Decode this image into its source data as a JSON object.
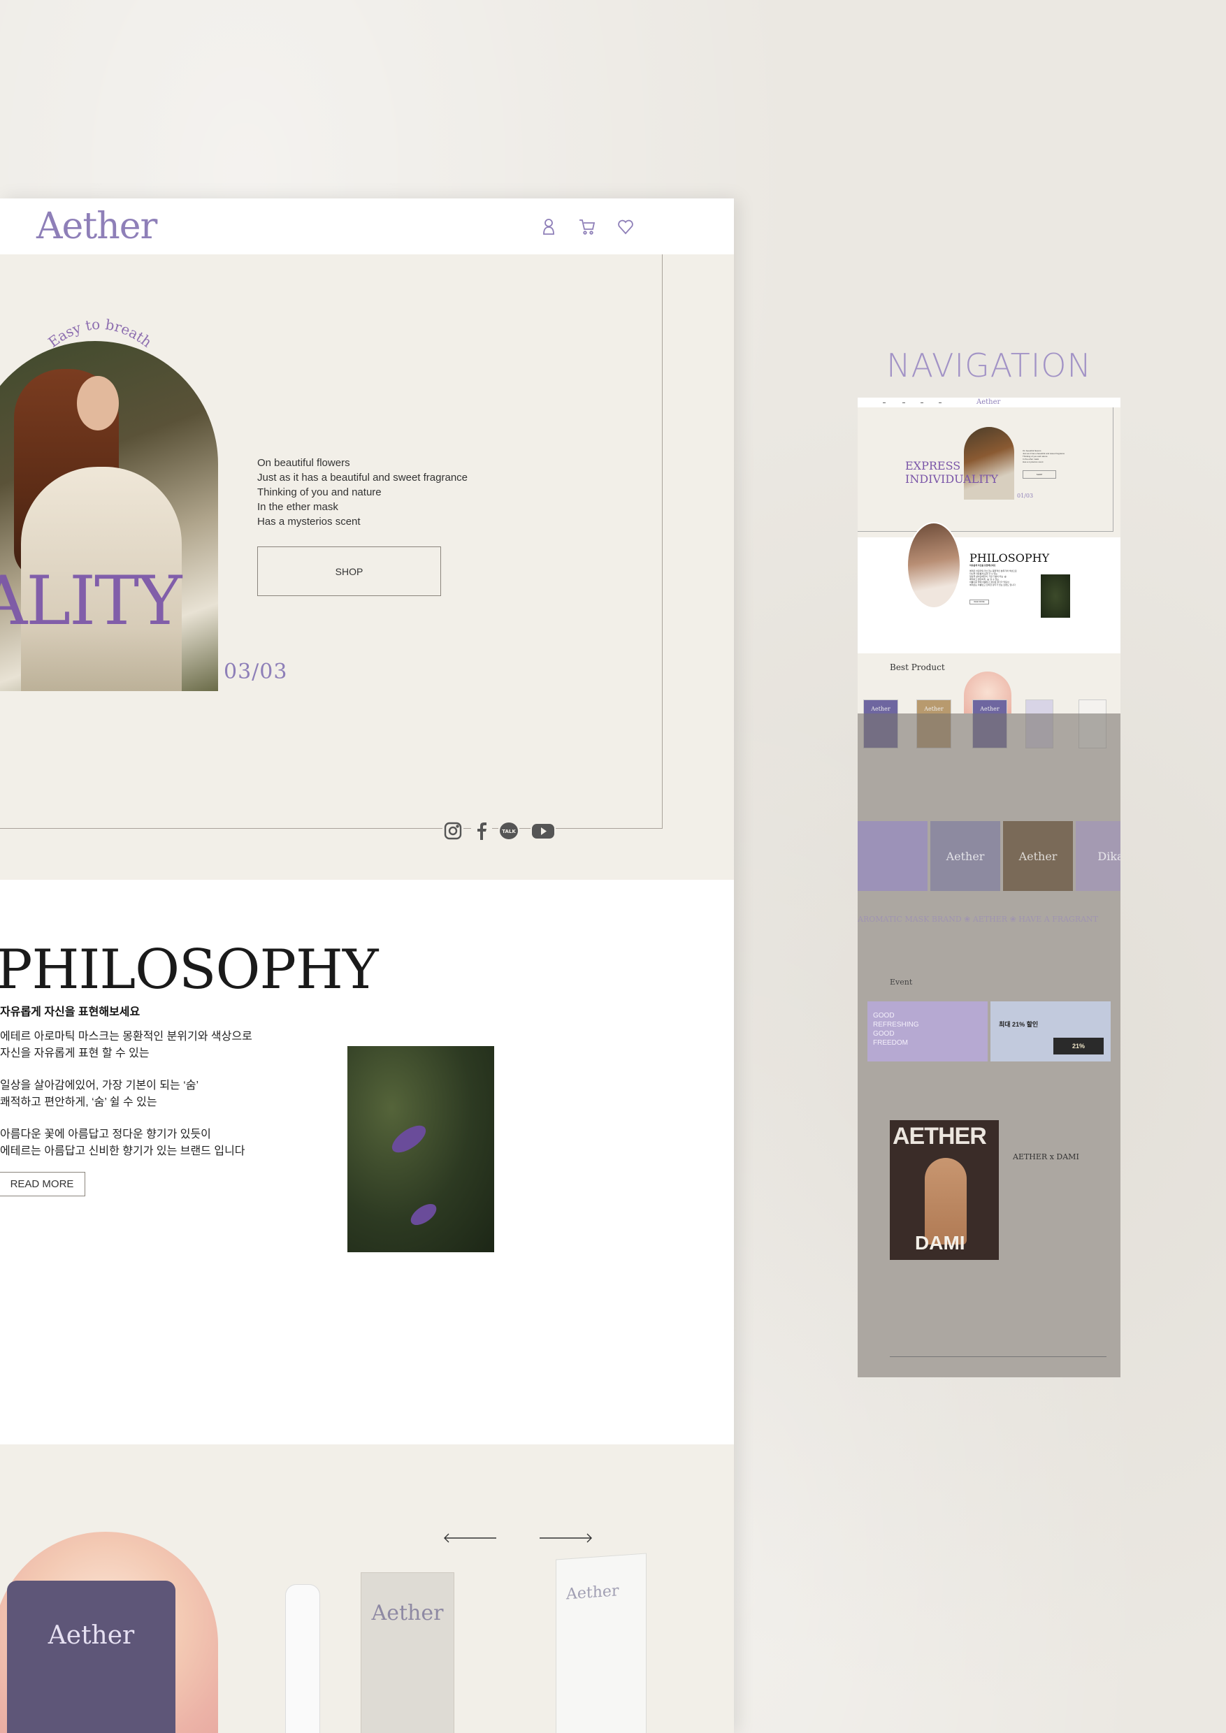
{
  "header": {
    "logo": "Aether",
    "icons": [
      "user-icon",
      "cart-icon",
      "heart-icon"
    ]
  },
  "hero": {
    "arc_text": "Easy to breath",
    "big_text": "ALITY",
    "counter": "03/03",
    "copy_lines": [
      "On beautiful flowers",
      "Just as it has a beautiful and sweet fragrance",
      "Thinking of you and nature",
      "In the ether mask",
      "Has a mysterios scent"
    ],
    "shop_label": "SHOP",
    "social": [
      "instagram-icon",
      "facebook-icon",
      "talk-icon",
      "youtube-icon"
    ]
  },
  "philosophy": {
    "title": "PHILOSOPHY",
    "subtitle": "자유롭게 자신을 표현해보세요",
    "paragraphs": [
      [
        "에테르 아로마틱 마스크는 몽환적인 분위기와 색상으로",
        "자신을 자유롭게 표현 할 수 있는"
      ],
      [
        "일상을 살아감에있어, 가장 기본이 되는 ‘숨’",
        "쾌적하고 편안하게, ‘숨’ 쉴 수 있는"
      ],
      [
        "아름다운 꽃에 아름답고 정다운 향기가 있듯이",
        "에테르는 아름답고 신비한 향기가 있는 브랜드 입니다"
      ]
    ],
    "read_more": "READ MORE"
  },
  "best_product": {
    "pack_label": "Aether",
    "box_label": "Aether",
    "pump_label": "Aether"
  },
  "navigation": {
    "title": "NAVIGATION",
    "thumb": {
      "logo": "Aether",
      "express": "EXPRESS",
      "individuality": "INDIVIDUALITY",
      "counter": "01/03",
      "philosophy": "PHILOSOPHY",
      "best_product": "Best Product",
      "product_label": "Aether",
      "marquee": "AROMATIC MASK BRAND ❀ AETHER ❀ HAVE A FRAGRANT",
      "event": "Event",
      "event1_lines": [
        "GOOD",
        "REFRESHING",
        "GOOD",
        "FREEDOM"
      ],
      "event2_title": "최대 21% 할인",
      "event2_tag": "21%",
      "mag_title": "AETHER",
      "mag_name": "DAMI",
      "collab": "AETHER x DAMI",
      "tile_texts": [
        "Aether",
        "Aether",
        "Aether",
        "Dika"
      ]
    }
  },
  "colors": {
    "accent": "#8e7fb8",
    "accent_dark": "#7a55a8",
    "page_bg": "#ebe8e2",
    "section_bg": "#f2efe8"
  }
}
